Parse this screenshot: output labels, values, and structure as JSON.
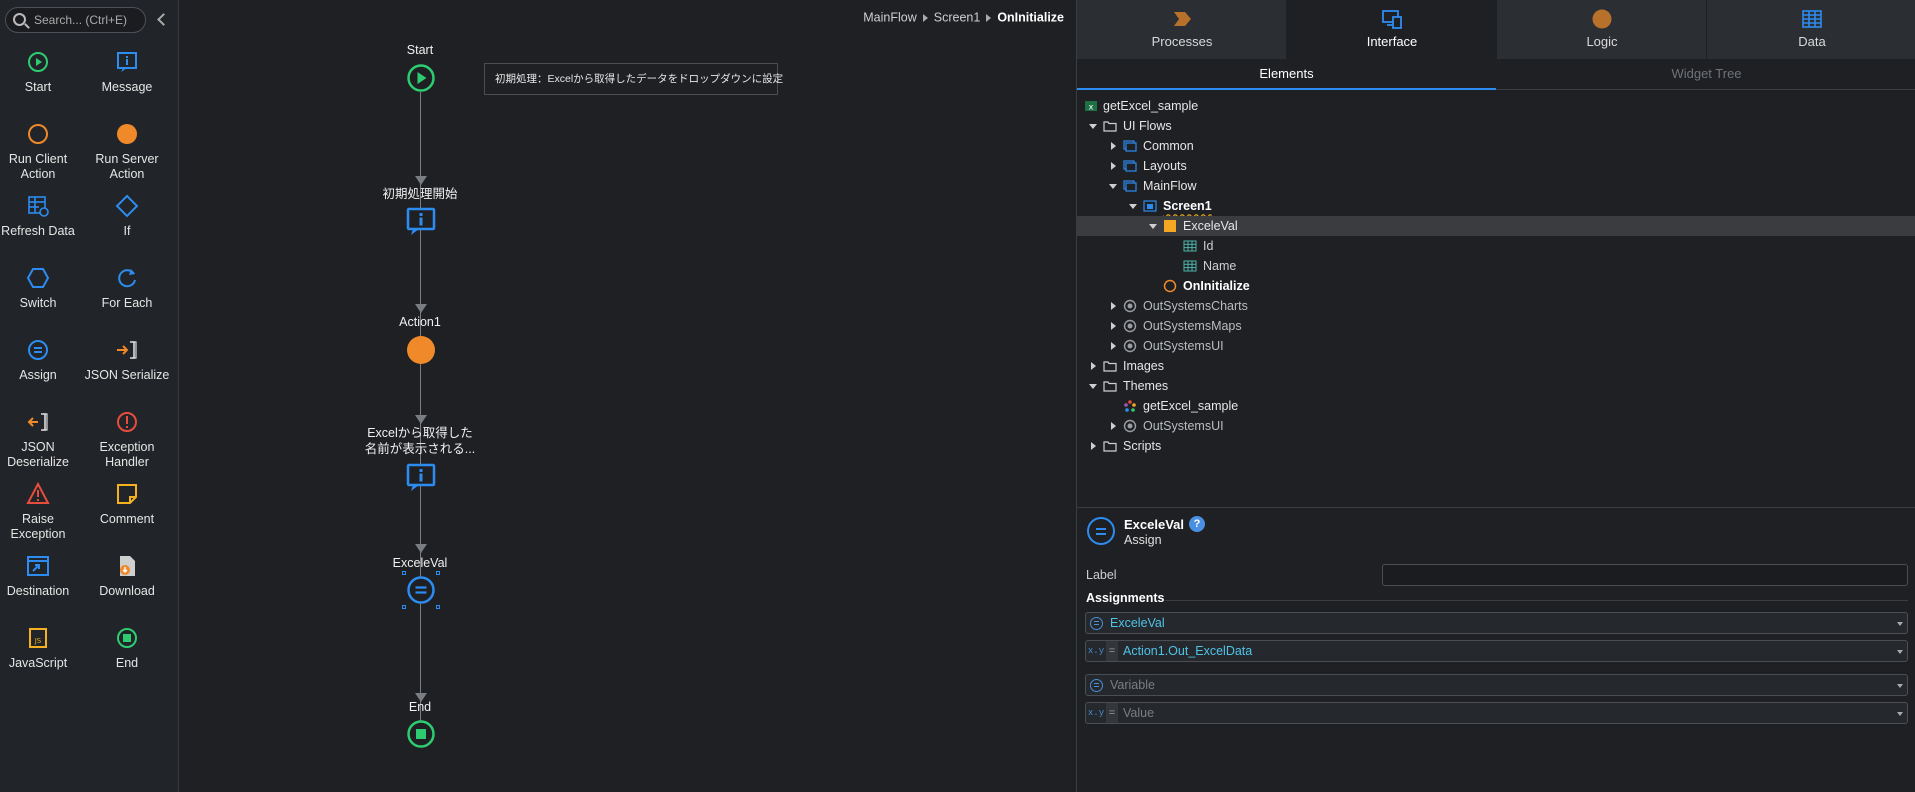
{
  "toolbox": {
    "search_placeholder": "Search... (Ctrl+E)",
    "tools": [
      {
        "label": "Start",
        "icon": "start-icon"
      },
      {
        "label": "Message",
        "icon": "message-icon"
      },
      {
        "label": "Run Client Action",
        "icon": "run-client-action-icon"
      },
      {
        "label": "Run Server Action",
        "icon": "run-server-action-icon"
      },
      {
        "label": "Refresh Data",
        "icon": "refresh-data-icon"
      },
      {
        "label": "If",
        "icon": "if-icon"
      },
      {
        "label": "Switch",
        "icon": "switch-icon"
      },
      {
        "label": "For Each",
        "icon": "for-each-icon"
      },
      {
        "label": "Assign",
        "icon": "assign-icon"
      },
      {
        "label": "JSON Serialize",
        "icon": "json-serialize-icon"
      },
      {
        "label": "JSON Deserialize",
        "icon": "json-deserialize-icon"
      },
      {
        "label": "Exception Handler",
        "icon": "exception-handler-icon"
      },
      {
        "label": "Raise Exception",
        "icon": "raise-exception-icon"
      },
      {
        "label": "Comment",
        "icon": "comment-icon"
      },
      {
        "label": "Destination",
        "icon": "destination-icon"
      },
      {
        "label": "Download",
        "icon": "download-icon"
      },
      {
        "label": "JavaScript",
        "icon": "javascript-icon"
      },
      {
        "label": "End",
        "icon": "end-icon"
      }
    ]
  },
  "canvas": {
    "breadcrumb": [
      "MainFlow",
      "Screen1",
      "OnInitialize"
    ],
    "comment": "初期処理：Excelから取得したデータをドロップダウンに設定",
    "nodes": [
      {
        "label": "Start",
        "kind": "start"
      },
      {
        "label": "初期処理開始",
        "kind": "message"
      },
      {
        "label": "Action1",
        "kind": "server-action"
      },
      {
        "label": "Excelから取得した\n名前が表示される...",
        "kind": "message"
      },
      {
        "label": "ExceleVal",
        "kind": "assign"
      },
      {
        "label": "End",
        "kind": "end"
      }
    ]
  },
  "panel": {
    "tabs": [
      {
        "label": "Processes",
        "icon": "processes-icon"
      },
      {
        "label": "Interface",
        "icon": "interface-icon"
      },
      {
        "label": "Logic",
        "icon": "logic-icon"
      },
      {
        "label": "Data",
        "icon": "data-icon"
      }
    ],
    "active_tab": "Interface",
    "subtabs": [
      "Elements",
      "Widget Tree"
    ],
    "tree": [
      {
        "label": "getExcel_sample",
        "icon": "excel-icon"
      },
      {
        "label": "UI Flows",
        "icon": "folder-icon"
      },
      {
        "label": "Common",
        "icon": "ui-flow-icon"
      },
      {
        "label": "Layouts",
        "icon": "ui-flow-icon"
      },
      {
        "label": "MainFlow",
        "icon": "ui-flow-icon"
      },
      {
        "label": "Screen1",
        "icon": "screen-icon"
      },
      {
        "label": "ExceleVal",
        "icon": "local-variable-icon"
      },
      {
        "label": "Id",
        "icon": "attribute-icon"
      },
      {
        "label": "Name",
        "icon": "attribute-icon"
      },
      {
        "label": "OnInitialize",
        "icon": "client-action-icon"
      },
      {
        "label": "OutSystemsCharts",
        "icon": "module-icon"
      },
      {
        "label": "OutSystemsMaps",
        "icon": "module-icon"
      },
      {
        "label": "OutSystemsUI",
        "icon": "module-icon"
      },
      {
        "label": "Images",
        "icon": "folder-icon"
      },
      {
        "label": "Themes",
        "icon": "folder-icon"
      },
      {
        "label": "getExcel_sample",
        "icon": "theme-icon"
      },
      {
        "label": "OutSystemsUI",
        "icon": "module-icon"
      },
      {
        "label": "Scripts",
        "icon": "folder-icon"
      }
    ],
    "props": {
      "title": "ExceleVal",
      "type": "Assign",
      "help": "?",
      "label_caption": "Label",
      "label_value": "",
      "assignments_caption": "Assignments",
      "assignments": [
        {
          "variable": "ExceleVal",
          "value": "Action1.Out_ExcelData"
        }
      ],
      "variable_placeholder": "Variable",
      "value_placeholder": "Value",
      "xy": "x.y",
      "eq": "="
    }
  }
}
